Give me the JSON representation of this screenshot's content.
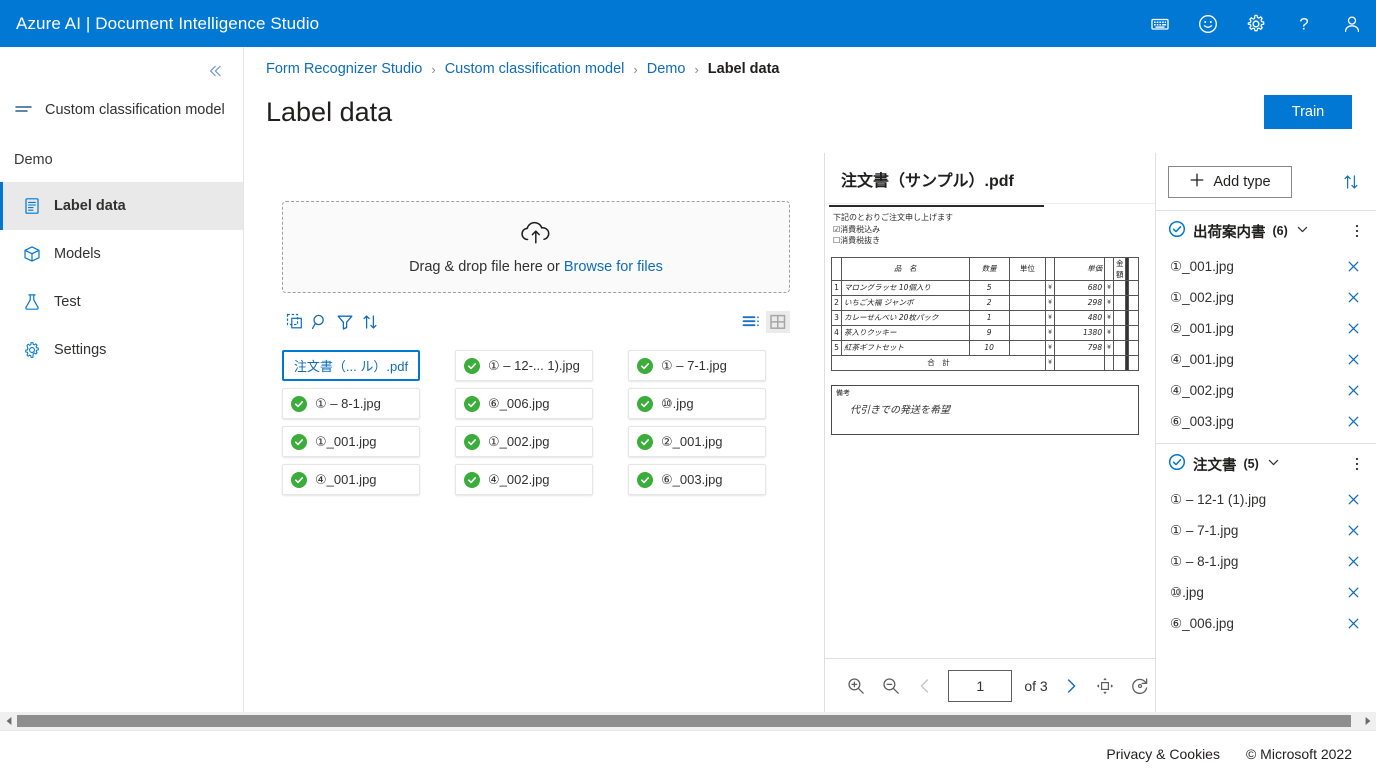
{
  "topbar": {
    "title": "Azure AI | Document Intelligence Studio",
    "icons": [
      {
        "name": "keyboard-icon",
        "label": "Keyboard shortcuts"
      },
      {
        "name": "feedback-smiley-icon",
        "label": "Feedback"
      },
      {
        "name": "gear-icon",
        "label": "Settings"
      },
      {
        "name": "help-icon",
        "label": "?"
      },
      {
        "name": "account-person-icon",
        "label": "Account"
      }
    ]
  },
  "sidebar": {
    "collapse_label": "«",
    "model_label": "Custom classification model",
    "project_label": "Demo",
    "items": [
      {
        "label": "Label data",
        "icon": "document-icon",
        "selected": true
      },
      {
        "label": "Models",
        "icon": "package-icon",
        "selected": false
      },
      {
        "label": "Test",
        "icon": "flask-icon",
        "selected": false
      },
      {
        "label": "Settings",
        "icon": "gear-icon",
        "selected": false
      }
    ]
  },
  "breadcrumb": {
    "items": [
      "Form Recognizer Studio",
      "Custom classification model",
      "Demo"
    ],
    "current": "Label data",
    "separator": "›"
  },
  "header": {
    "page_title": "Label data",
    "train_label": "Train"
  },
  "dropzone": {
    "icon": "cloud-upload-icon",
    "text_before": "Drag & drop file here or ",
    "browse_label": "Browse for files"
  },
  "file_toolbar": {
    "left_icons": [
      {
        "name": "select-all-icon"
      },
      {
        "name": "search-icon"
      },
      {
        "name": "filter-icon"
      },
      {
        "name": "sort-icon"
      }
    ],
    "right_icons": [
      {
        "name": "list-view-icon",
        "active": true
      },
      {
        "name": "grid-view-icon",
        "active": false
      }
    ]
  },
  "files": [
    {
      "name": "注文書（... ル）.pdf",
      "selected": true,
      "labeled": false
    },
    {
      "name": "① – 12-... 1).jpg",
      "selected": false,
      "labeled": true
    },
    {
      "name": "① – 7-1.jpg",
      "selected": false,
      "labeled": true
    },
    {
      "name": "① – 8-1.jpg",
      "selected": false,
      "labeled": true
    },
    {
      "name": "⑥_006.jpg",
      "selected": false,
      "labeled": true
    },
    {
      "name": "⑩.jpg",
      "selected": false,
      "labeled": true
    },
    {
      "name": "①_001.jpg",
      "selected": false,
      "labeled": true
    },
    {
      "name": "①_002.jpg",
      "selected": false,
      "labeled": true
    },
    {
      "name": "②_001.jpg",
      "selected": false,
      "labeled": true
    },
    {
      "name": "④_001.jpg",
      "selected": false,
      "labeled": true
    },
    {
      "name": "④_002.jpg",
      "selected": false,
      "labeled": true
    },
    {
      "name": "⑥_003.jpg",
      "selected": false,
      "labeled": true
    }
  ],
  "preview": {
    "title": "注文書（サンプル）.pdf",
    "scan": {
      "line1": "下記のとおりご注文申し上げます",
      "line2": "☑消費税込み",
      "line3": "☐消費税抜き",
      "headers": [
        "品　名",
        "数量",
        "単位",
        "単価",
        "金額"
      ],
      "rows": [
        {
          "no": "1",
          "name": "マロングラッセ 10個入り",
          "qty": "5",
          "unit": "",
          "price": "680"
        },
        {
          "no": "2",
          "name": "いちご大福 ジャンボ",
          "qty": "2",
          "unit": "",
          "price": "298"
        },
        {
          "no": "3",
          "name": "カレーせんべい 20枚パック",
          "qty": "1",
          "unit": "",
          "price": "480"
        },
        {
          "no": "4",
          "name": "茶入りクッキー",
          "qty": "9",
          "unit": "",
          "price": "1380"
        },
        {
          "no": "5",
          "name": "紅茶ギフトセット",
          "qty": "10",
          "unit": "",
          "price": "798"
        }
      ],
      "total_label": "合　計",
      "remark_label": "備考",
      "remark_text": "代引きでの発送を希望"
    },
    "pager": {
      "zoom_in": "zoom-in-icon",
      "zoom_out": "zoom-out-icon",
      "prev": "prev-page-icon",
      "page_value": "1",
      "of_label": "of 3",
      "next": "next-page-icon",
      "fit": "fit-to-page-icon",
      "rotate": "rotate-icon"
    }
  },
  "types": {
    "add_type_label": "Add type",
    "add_icon": "plus-icon",
    "sort_icon": "sort-icon",
    "groups": [
      {
        "name": "出荷案内書",
        "count": "(6)",
        "files": [
          "①_001.jpg",
          "①_002.jpg",
          "②_001.jpg",
          "④_001.jpg",
          "④_002.jpg",
          "⑥_003.jpg"
        ]
      },
      {
        "name": "注文書",
        "count": "(5)",
        "files": [
          "① – 12-1 (1).jpg",
          "① – 7-1.jpg",
          "① – 8-1.jpg",
          "⑩.jpg",
          "⑥_006.jpg"
        ]
      }
    ]
  },
  "footer": {
    "privacy": "Privacy & Cookies",
    "copyright": "© Microsoft 2022"
  },
  "colors": {
    "brand_blue": "#0078d4",
    "link_blue": "#0f6cbd",
    "check_green": "#3aad3a",
    "selected_bg": "#e9e9e9"
  }
}
